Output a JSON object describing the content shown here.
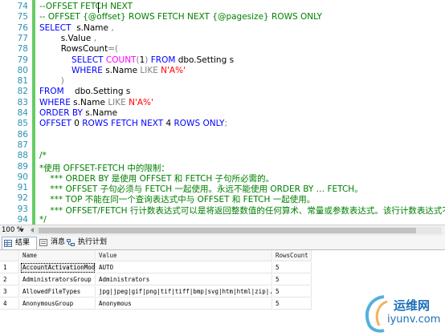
{
  "editor": {
    "lines": [
      {
        "num": "74",
        "parts": [
          {
            "c": "cm",
            "t": "--OFFSET FETCH NEXT"
          }
        ]
      },
      {
        "num": "75",
        "parts": [
          {
            "c": "cm",
            "t": "-- OFFSET {@offset} ROWS FETCH NEXT {@pagesize} ROWS ONLY"
          }
        ]
      },
      {
        "num": "76",
        "parts": [
          {
            "c": "kw",
            "t": "SELECT"
          },
          {
            "c": "",
            "t": "  s.Name "
          },
          {
            "c": "gr",
            "t": ","
          }
        ]
      },
      {
        "num": "77",
        "parts": [
          {
            "c": "",
            "t": "        s.Value "
          },
          {
            "c": "gr",
            "t": ","
          }
        ]
      },
      {
        "num": "78",
        "parts": [
          {
            "c": "",
            "t": "        RowsCount"
          },
          {
            "c": "gr",
            "t": "=("
          }
        ]
      },
      {
        "num": "79",
        "parts": [
          {
            "c": "kw",
            "t": "            SELECT "
          },
          {
            "c": "fn",
            "t": "COUNT"
          },
          {
            "c": "gr",
            "t": "("
          },
          {
            "c": "",
            "t": "1"
          },
          {
            "c": "gr",
            "t": ")"
          },
          {
            "c": "kw",
            "t": " FROM"
          },
          {
            "c": "",
            "t": " dbo.Setting s"
          }
        ]
      },
      {
        "num": "80",
        "parts": [
          {
            "c": "kw",
            "t": "            WHERE"
          },
          {
            "c": "",
            "t": " s.Name "
          },
          {
            "c": "gr",
            "t": "LIKE"
          },
          {
            "c": "str",
            "t": " N'A%'"
          }
        ]
      },
      {
        "num": "81",
        "parts": [
          {
            "c": "gr",
            "t": "        )"
          }
        ]
      },
      {
        "num": "82",
        "parts": [
          {
            "c": "kw",
            "t": "FROM"
          },
          {
            "c": "",
            "t": "    dbo.Setting s"
          }
        ]
      },
      {
        "num": "83",
        "parts": [
          {
            "c": "kw",
            "t": "WHERE"
          },
          {
            "c": "",
            "t": " s.Name "
          },
          {
            "c": "gr",
            "t": "LIKE"
          },
          {
            "c": "str",
            "t": " N'A%'"
          }
        ]
      },
      {
        "num": "84",
        "parts": [
          {
            "c": "kw",
            "t": "ORDER BY"
          },
          {
            "c": "",
            "t": " s.Name"
          }
        ]
      },
      {
        "num": "85",
        "parts": [
          {
            "c": "kw",
            "t": "OFFSET"
          },
          {
            "c": "",
            "t": " 0 "
          },
          {
            "c": "kw",
            "t": "ROWS FETCH NEXT"
          },
          {
            "c": "",
            "t": " 4 "
          },
          {
            "c": "kw",
            "t": "ROWS ONLY"
          },
          {
            "c": "gr",
            "t": ";"
          }
        ]
      },
      {
        "num": "86",
        "parts": [
          {
            "c": "",
            "t": ""
          }
        ]
      },
      {
        "num": "87",
        "parts": [
          {
            "c": "",
            "t": ""
          }
        ]
      },
      {
        "num": "88",
        "parts": [
          {
            "c": "cm",
            "t": "/*"
          }
        ]
      },
      {
        "num": "89",
        "parts": [
          {
            "c": "cm",
            "t": "*使用 OFFSET-FETCH 中的限制："
          }
        ]
      },
      {
        "num": "90",
        "parts": [
          {
            "c": "cm",
            "t": "    *** ORDER BY 是使用 OFFSET 和 FETCH 子句所必需的。"
          }
        ]
      },
      {
        "num": "91",
        "parts": [
          {
            "c": "cm",
            "t": "    *** OFFSET 子句必须与 FETCH 一起使用。永远不能使用 ORDER BY … FETCH。"
          }
        ]
      },
      {
        "num": "92",
        "parts": [
          {
            "c": "cm",
            "t": "    *** TOP 不能在同一个查询表达式中与 OFFSET 和 FETCH 一起使用。"
          }
        ]
      },
      {
        "num": "93",
        "parts": [
          {
            "c": "cm",
            "t": "    *** OFFSET/FETCH 行计数表达式可以是将返回整数值的任何算术、常量或参数表达式。该行计数表达式不支持标量子查询。"
          }
        ]
      },
      {
        "num": "94",
        "parts": [
          {
            "c": "cm",
            "t": "*/"
          }
        ]
      }
    ]
  },
  "status": {
    "zoom": "100 %"
  },
  "tabs": {
    "results": "结果",
    "messages": "消息",
    "plan": "执行计划"
  },
  "grid": {
    "columns": [
      "Name",
      "Value",
      "RowsCount"
    ],
    "rows": [
      {
        "n": "1",
        "name": "AccountActivationMode",
        "value": "AUTO",
        "count": "5"
      },
      {
        "n": "2",
        "name": "AdministratorsGroup",
        "value": "Administrators",
        "count": "5"
      },
      {
        "n": "3",
        "name": "AllowedFileTypes",
        "value": "jpg|jpeg|gif|png|tif|tiff|bmp|svg|htm|html|zip|...",
        "count": "5"
      },
      {
        "n": "4",
        "name": "AnonymousGroup",
        "value": "Anonymous",
        "count": "5"
      }
    ]
  },
  "watermark": {
    "cn": "运维网",
    "en": "iyunv.com"
  },
  "colors": {
    "keyword": "#0000ff",
    "function": "#ff00ff",
    "string": "#ff0000",
    "operator": "#808080",
    "comment": "#008000",
    "linenumber": "#2b91af"
  }
}
